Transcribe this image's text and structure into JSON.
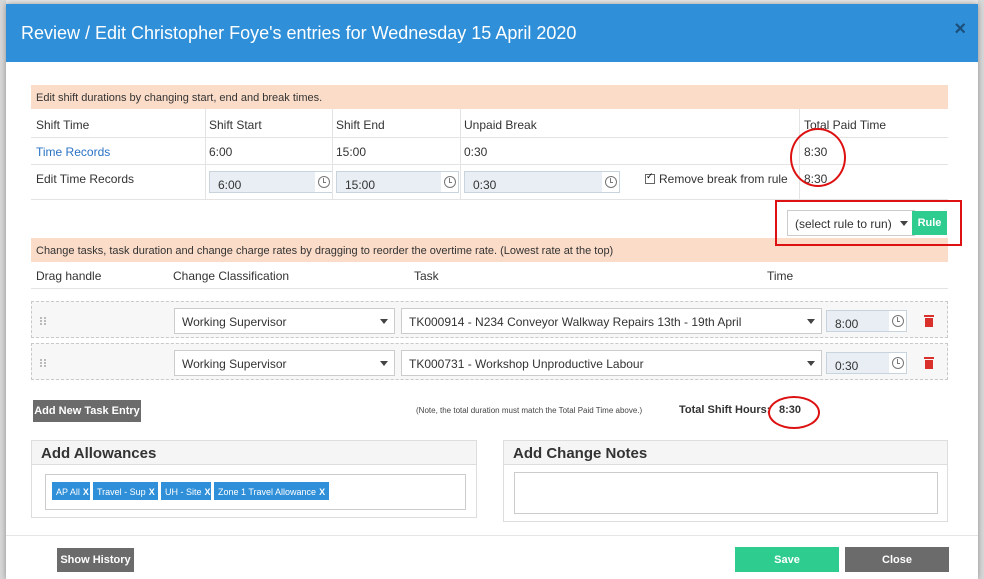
{
  "modal": {
    "title": "Review / Edit Christopher Foye's entries for Wednesday 15 April 2020",
    "close_symbol": "×"
  },
  "shift_section": {
    "banner": "Edit shift durations by changing start, end and break times.",
    "headers": {
      "shift_time": "Shift Time",
      "shift_start": "Shift Start",
      "shift_end": "Shift End",
      "unpaid_break": "Unpaid Break",
      "total_paid_time": "Total Paid Time"
    },
    "time_records": {
      "label": "Time Records",
      "start": "6:00",
      "end": "15:00",
      "break": "0:30",
      "total": "8:30"
    },
    "edit_records": {
      "label": "Edit Time Records",
      "start": "6:00",
      "end": "15:00",
      "break": "0:30",
      "remove_break_label": "Remove break from rule",
      "remove_break_checked": true,
      "total": "8:30"
    }
  },
  "rule": {
    "select_value": "(select rule to run)",
    "button_label": "Rule"
  },
  "task_section": {
    "banner": "Change tasks, task duration and change charge rates by dragging to reorder the overtime rate. (Lowest rate at the top)",
    "headers": {
      "drag_handle": "Drag handle",
      "classification": "Change Classification",
      "task": "Task",
      "time": "Time"
    },
    "entries": [
      {
        "classification": "Working Supervisor",
        "task": "TK000914 - N234 Conveyor Walkway Repairs 13th - 19th April",
        "time": "8:00"
      },
      {
        "classification": "Working Supervisor",
        "task": "TK000731 - Workshop Unproductive Labour",
        "time": "0:30"
      }
    ],
    "add_button": "Add New Task Entry",
    "note": "(Note, the total duration must match the Total Paid Time above.)",
    "total_label": "Total Shift Hours:",
    "total_value": "8:30"
  },
  "allowances": {
    "title": "Add Allowances",
    "tags": [
      "AP All",
      "Travel - Sup",
      "UH - Site",
      "Zone 1 Travel Allowance"
    ],
    "remove_symbol": "X"
  },
  "notes": {
    "title": "Add Change Notes",
    "value": ""
  },
  "footer": {
    "history_button": "Show History",
    "save_button": "Save",
    "close_button": "Close"
  },
  "colors": {
    "header_blue": "#2f8fd8",
    "banner_peach": "#fbdcc8",
    "save_green": "#2ecc8f",
    "annotation_red": "#d11111"
  }
}
